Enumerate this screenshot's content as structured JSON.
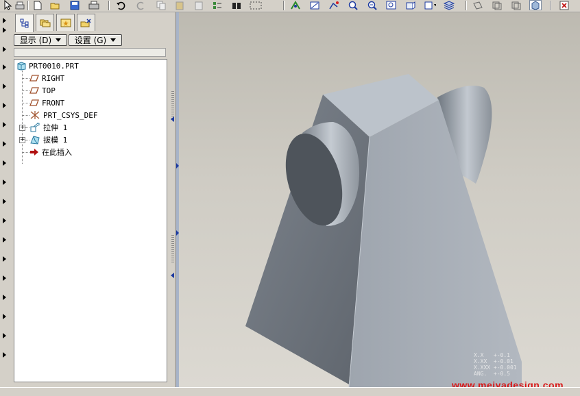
{
  "toolbar": {
    "icons": [
      "pointer-icon",
      "print-icon",
      "new-icon",
      "open-icon",
      "save-icon",
      "printer-icon",
      "undo-icon",
      "redo-icon",
      "copy-icon",
      "paste-icon",
      "paste-special-icon",
      "regenerate-icon",
      "find-icon",
      "select-box-icon",
      "repaint-icon",
      "spin-center-icon",
      "orient-icon",
      "zoom-in-icon",
      "zoom-out-icon",
      "refit-icon",
      "saved-views-icon",
      "view-manager-icon",
      "layers-icon",
      "plane-display-icon",
      "axis-display-icon",
      "csys-display-icon",
      "shaded-display-icon",
      "close-window-icon"
    ]
  },
  "navigator": {
    "tabs": [
      "model-tree-tab",
      "folder-browser-tab",
      "favorites-tab",
      "connections-tab"
    ],
    "show_button": "显示 (D)",
    "settings_button": "设置 (G)"
  },
  "tree": {
    "root": "PRT0010.PRT",
    "items": [
      {
        "label": "RIGHT",
        "icon": "datum-plane-icon"
      },
      {
        "label": "TOP",
        "icon": "datum-plane-icon"
      },
      {
        "label": "FRONT",
        "icon": "datum-plane-icon"
      },
      {
        "label": "PRT_CSYS_DEF",
        "icon": "csys-icon"
      },
      {
        "label": "拉伸 1",
        "icon": "extrude-icon"
      },
      {
        "label": "拔模 1",
        "icon": "draft-icon"
      },
      {
        "label": "在此插入",
        "icon": "insert-here-arrow-icon"
      }
    ]
  },
  "viewport": {
    "accuracy_lines": [
      "X.X   +-0.1",
      "X.XX  +-0.01",
      "X.XXX +-0.001",
      "ANG.  +-0.5"
    ],
    "watermark": "www.meiyadesign.com"
  },
  "colors": {
    "accent_blue": "#1c3aa0",
    "model_face": "#a9b0b9",
    "watermark": "#d81818"
  }
}
